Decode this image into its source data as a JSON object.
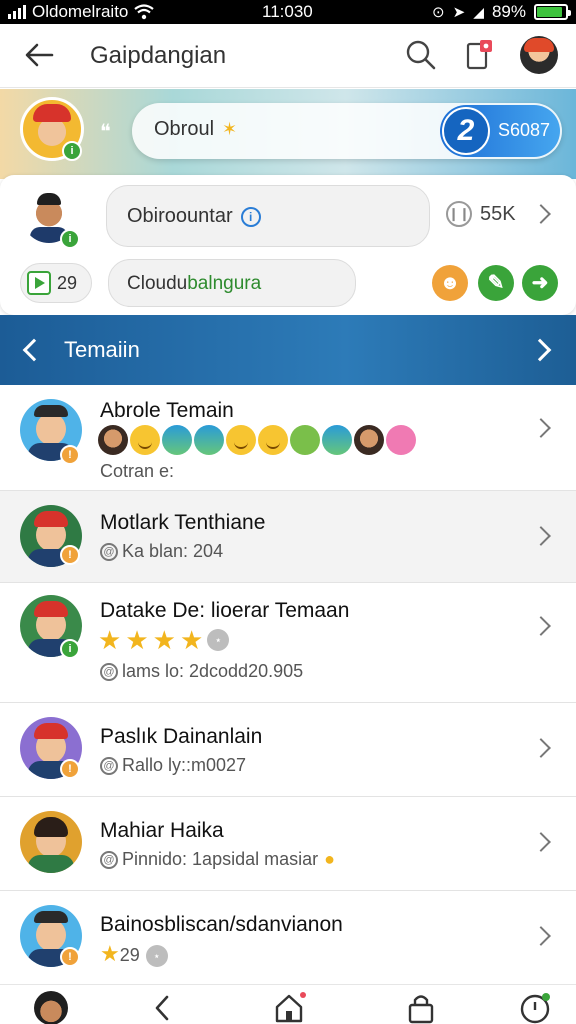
{
  "status_bar": {
    "carrier": "Oldomelraito",
    "time": "11:030",
    "battery": "89%",
    "battery_level": 0.89
  },
  "header": {
    "title": "Gaipdangian"
  },
  "banner": {
    "pill_text": "Obroul",
    "count_number": "2",
    "count_text": "S6087",
    "avatar_badge": "i"
  },
  "card": {
    "primary_text": "Obiroountar",
    "count": "55K",
    "play_count": "29",
    "secondary_text_a": "Cloudu",
    "secondary_text_b": "balngura",
    "avatar_badge": "i"
  },
  "section": {
    "title": "Temaiin"
  },
  "list": [
    {
      "title": "Abrole Temain",
      "subtitle": "Cotran e:",
      "badge": "!"
    },
    {
      "title": "Motlark Tenthiane",
      "subtitle": "Ka blan: 204",
      "badge": "!"
    },
    {
      "title": "Datake De: lioerar Temaan",
      "subtitle": "lams lo: 2dcodd20.905",
      "badge": "i"
    },
    {
      "title": "Paslık Dainanlain",
      "subtitle": "Rallo ly::m0027",
      "badge": "!"
    },
    {
      "title": "Mahiar Haika",
      "subtitle": "Pinnido: 1apsidal masiar",
      "badge": ""
    },
    {
      "title": "Bainosbliscan/sdanvianon",
      "subtitle": "29",
      "badge": "!"
    }
  ],
  "colors": {
    "accent": "#2d7bb8",
    "green": "#3aa43a",
    "orange": "#f0a23a",
    "star": "#f2b51e"
  },
  "icons": [
    "back-arrow-icon",
    "search-icon",
    "notification-icon",
    "home-icon",
    "lock-icon",
    "chevron-right-icon",
    "info-icon"
  ]
}
